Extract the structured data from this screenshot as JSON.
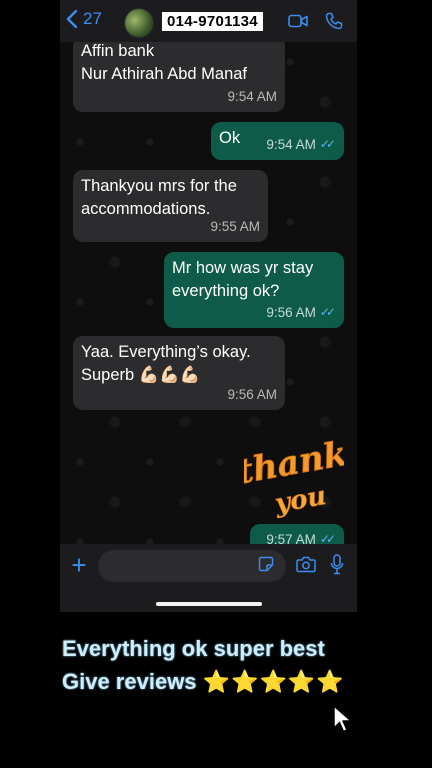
{
  "header": {
    "back_count": "27",
    "contact_number": "014-9701134"
  },
  "messages": [
    {
      "dir": "in",
      "lines": [
        "Affin bank",
        "Nur Athirah Abd Manaf"
      ],
      "time": "9:54 AM"
    },
    {
      "dir": "out",
      "text": "Ok",
      "time": "9:54 AM"
    },
    {
      "dir": "in",
      "lines": [
        "Thankyou mrs for the",
        "accommodations."
      ],
      "time": "9:55 AM"
    },
    {
      "dir": "out",
      "lines": [
        "Mr how was yr stay",
        "everything ok?"
      ],
      "time": "9:56 AM"
    },
    {
      "dir": "in",
      "lines": [
        "Yaa. Everything’s okay.",
        "Superb 💪🏻💪🏻💪🏻"
      ],
      "time": "9:56 AM"
    },
    {
      "dir": "out",
      "time": "9:57 AM"
    }
  ],
  "sticker": {
    "line1": "thank",
    "line2": "you"
  },
  "composer": {
    "placeholder": ""
  },
  "caption": {
    "line1": "Everything ok super best",
    "line2": "Give reviews",
    "stars": "⭐⭐⭐⭐⭐"
  },
  "colors": {
    "accent": "#3b8ef0",
    "incoming_bubble": "#2c2c2e",
    "outgoing_bubble": "#0f5b49",
    "read_ticks": "#58b6ec"
  }
}
